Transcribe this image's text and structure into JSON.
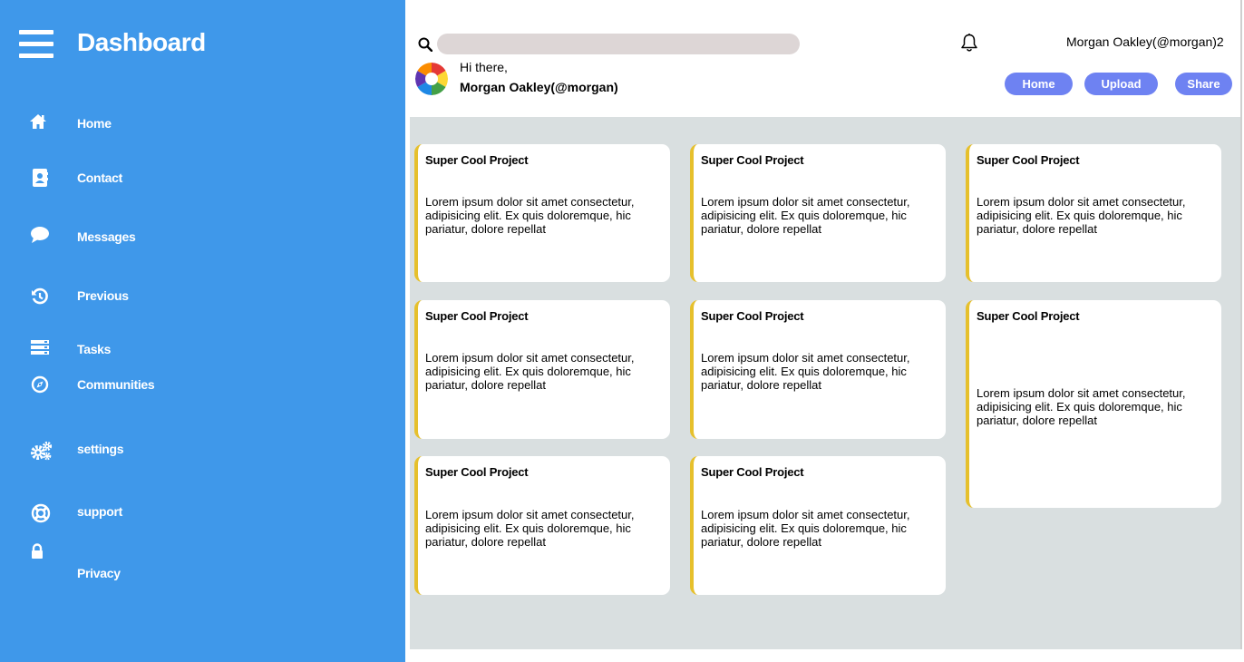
{
  "sidebar": {
    "brand": "Dashboard",
    "items": [
      {
        "label": "Home",
        "icon": "home-icon"
      },
      {
        "label": "Contact",
        "icon": "contact-card-icon"
      },
      {
        "label": "Messages",
        "icon": "speech-bubble-icon"
      },
      {
        "label": "Previous",
        "icon": "history-icon"
      },
      {
        "label": "Tasks",
        "icon": "tasks-list-icon"
      },
      {
        "label": "Communities",
        "icon": "compass-icon"
      },
      {
        "label": "settings",
        "icon": "gears-icon"
      },
      {
        "label": "support",
        "icon": "lifebuoy-icon"
      },
      {
        "label": "Privacy",
        "icon": "lock-icon"
      }
    ]
  },
  "header": {
    "search": {
      "placeholder": "",
      "value": ""
    },
    "user_handle": "Morgan Oakley(@morgan)2",
    "greeting": "Hi there,",
    "greeting_name": "Morgan Oakley(@morgan)",
    "buttons": {
      "home": "Home",
      "upload": "Upload",
      "share": "Share"
    }
  },
  "cards": [
    {
      "title": "Super Cool Project",
      "body": "Lorem ipsum dolor sit amet consectetur, adipisicing elit. Ex quis doloremque, hic pariatur, dolore repellat"
    },
    {
      "title": "Super Cool Project",
      "body": "Lorem ipsum dolor sit amet consectetur, adipisicing elit. Ex quis doloremque, hic pariatur, dolore repellat"
    },
    {
      "title": "Super Cool Project",
      "body": "Lorem ipsum dolor sit amet consectetur, adipisicing elit. Ex quis doloremque, hic pariatur, dolore repellat"
    },
    {
      "title": "Super Cool Project",
      "body": "Lorem ipsum dolor sit amet consectetur, adipisicing elit. Ex quis doloremque, hic pariatur, dolore repellat"
    },
    {
      "title": "Super Cool Project",
      "body": "Lorem ipsum dolor sit amet consectetur, adipisicing elit. Ex quis doloremque, hic pariatur, dolore repellat"
    },
    {
      "title": "Super Cool Project",
      "body": "Lorem ipsum dolor sit amet consectetur, adipisicing elit. Ex quis doloremque, hic pariatur, dolore repellat"
    },
    {
      "title": "Super Cool Project",
      "body": "Lorem ipsum dolor sit amet consectetur, adipisicing elit. Ex quis doloremque, hic pariatur, dolore repellat"
    },
    {
      "title": "Super Cool Project",
      "body": "Lorem ipsum dolor sit amet consectetur, adipisicing elit. Ex quis doloremque, hic pariatur, dolore repellat"
    }
  ],
  "colors": {
    "sidebar_bg": "#3f98ea",
    "content_bg": "#d9dfe0",
    "button_bg": "#6e82f2",
    "card_accent": "#e6c02c",
    "search_bg": "#ddd6d6"
  }
}
